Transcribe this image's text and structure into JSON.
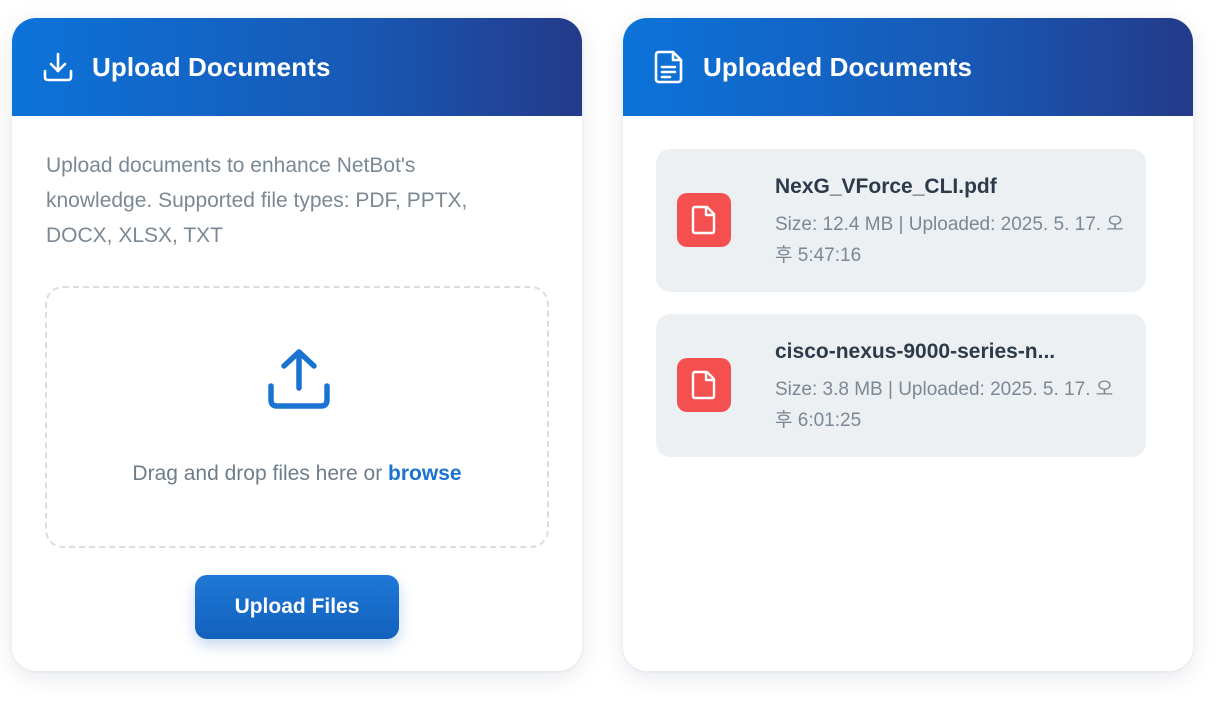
{
  "upload_panel": {
    "title": "Upload Documents",
    "icon": "download-icon",
    "description": "Upload documents to enhance NetBot's knowledge. Supported file types: PDF, PPTX, DOCX, XLSX, TXT",
    "dropzone": {
      "icon": "upload-icon",
      "text": "Drag and drop files here or ",
      "browse_label": "browse"
    },
    "button_label": "Upload Files"
  },
  "files_panel": {
    "title": "Uploaded Documents",
    "icon": "document-icon",
    "files": [
      {
        "name": "NexG_VForce_CLI.pdf",
        "meta": "Size: 12.4 MB | Uploaded: 2025. 5. 17. 오후 5:47:16",
        "icon": "file-icon"
      },
      {
        "name": "cisco-nexus-9000-series-n...",
        "meta": "Size: 3.8 MB | Uploaded: 2025. 5. 17. 오후 6:01:25",
        "icon": "file-icon"
      }
    ]
  },
  "colors": {
    "header_gradient_start": "#0c73d9",
    "header_gradient_end": "#243a8a",
    "accent": "#1a73d0",
    "file_icon_bg": "#f4504f",
    "file_item_bg": "#edf0f2"
  }
}
